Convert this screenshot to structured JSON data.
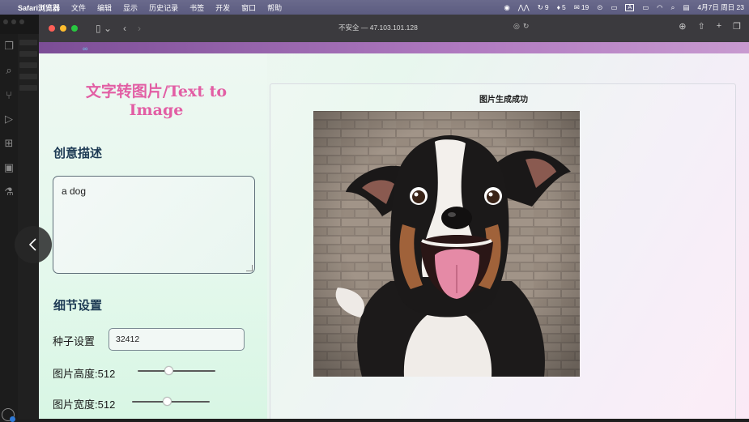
{
  "menubar": {
    "app_name": "Safari浏览器",
    "menus": [
      "文件",
      "编辑",
      "显示",
      "历史记录",
      "书签",
      "开发",
      "窗口",
      "帮助"
    ],
    "status": {
      "n1": "9",
      "n2": "5",
      "n3": "19",
      "input": "A",
      "clock": "4月7日 周日 23"
    }
  },
  "browser": {
    "url": "不安全 — 47.103.101.128",
    "traffic_lights": {
      "close": "#ff5f57",
      "minimize": "#febc2e",
      "zoom": "#28c840"
    }
  },
  "app": {
    "title": "文字转图片/Text to Image",
    "prompt_section": "创意描述",
    "prompt_value": "a dog",
    "details_section": "细节设置",
    "seed_label": "种子设置",
    "seed_value": "32412",
    "height_label": "图片高度:512",
    "height_level": 0.4,
    "width_label": "图片宽度:512",
    "width_level": 0.45,
    "result_status": "图片生成成功",
    "accent_color": "#e25ea4"
  }
}
